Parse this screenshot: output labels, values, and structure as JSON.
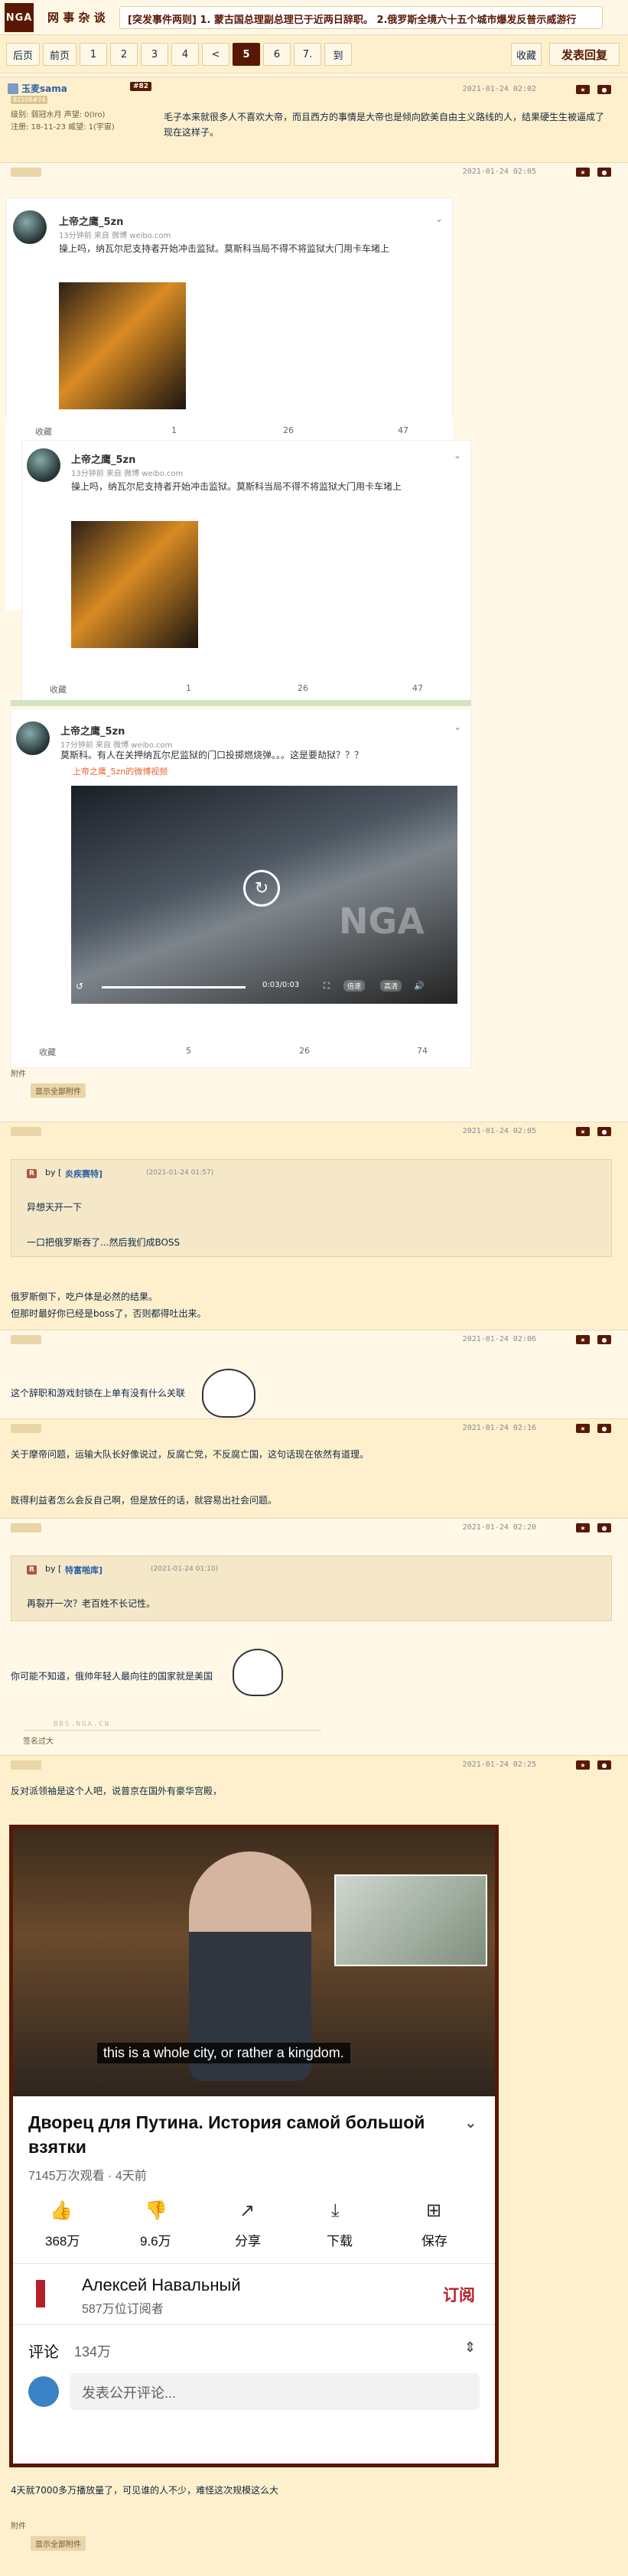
{
  "header": {
    "logo": "NGA",
    "forum": "网 事 杂 谈",
    "headline": "[突发事件两则] 1. 蒙古国总理副总理已于近两日辞职。 2.俄罗斯全境六十五个城市爆发反普示威游行"
  },
  "pager": {
    "items": [
      "后页",
      "前页",
      "1",
      "2",
      "3",
      "4",
      "<",
      "5",
      "6",
      "7.",
      "到"
    ],
    "current": "5",
    "fav": "收藏",
    "reply": "发表回复"
  },
  "posts": [
    {
      "user": "玉麦sama",
      "floor": "#82",
      "badge": "82109#74",
      "stats": [
        "级别: 弱冠水月  声望: 0(Iro)",
        "注册: 18-11-23  威望: 1(宇宙)"
      ],
      "time": "2021-01-24 02:02",
      "text": "毛子本来就很多人不喜欢大帝，而且西方的事情是大帝也是倾向欧美自由主义路线的人，结果硬生生被逼成了现在这样子。"
    },
    {
      "time": "2021-01-24 02:05",
      "weibo": [
        {
          "user": "上帝之鹰_5zn",
          "sub": "13分钟前 来自 微博 weibo.com",
          "text": "操上吗，纳瓦尔尼支持者开始冲击监狱。莫斯科当局不得不将监狱大门用卡车堵上",
          "actions": [
            "收藏",
            "1",
            "26",
            "47"
          ]
        },
        {
          "user": "上帝之鹰_5zn",
          "sub": "13分钟前 来自 微博 weibo.com",
          "text": "操上吗，纳瓦尔尼支持者开始冲击监狱。莫斯科当局不得不将监狱大门用卡车堵上",
          "actions": [
            "收藏",
            "1",
            "26",
            "47"
          ]
        },
        {
          "user": "上帝之鹰_5zn",
          "sub": "17分钟前 来自 微博 weibo.com",
          "text": "莫斯科。有人在关押纳瓦尔尼监狱的门口投掷燃烧弹。。。这是要劫狱？？？",
          "link": "上帝之鹰_5zn的微博视频",
          "video_time": "0:03/0:03",
          "video_btns": [
            "倍速",
            "高清"
          ],
          "actions": [
            "收藏",
            "5",
            "26",
            "74"
          ]
        }
      ],
      "attach": "附件",
      "show_attach": "显示全部附件"
    },
    {
      "time": "2021-01-24 02:05",
      "quote_by": "by [",
      "quote_user": "炎疾赛特]",
      "quote_time": "(2021-01-24 01:57)",
      "quote_lines": [
        "异想天开一下",
        "一口把俄罗斯吞了...然后我们成BOSS"
      ],
      "lines": [
        "俄罗斯倒下，吃户体是必然的结果。",
        "但那时最好你已经是boss了，否则都得吐出来。"
      ]
    },
    {
      "time": "2021-01-24 02:06",
      "text": "这个辞职和游戏封锁在上单有没有什么关联"
    },
    {
      "time": "2021-01-24 02:16",
      "lines": [
        "关于摩帝问题，运输大队长好像说过，反腐亡党，不反腐亡国，这句话现在依然有道理。",
        "既得利益者怎么会反自己啊，但是放任的话，就容易出社会问题。"
      ]
    },
    {
      "time": "2021-01-24 02:20",
      "quote_by": "by [",
      "quote_user": "特富啪库]",
      "quote_time": "(2021-01-24 01:10)",
      "quote_lines": [
        "再裂开一次？老百姓不长记性。"
      ],
      "text": "你可能不知道，俄帅年轻人最向往的国家就是美国",
      "sig": "签名过大",
      "watermark": "BBS.NGA.CN"
    },
    {
      "time": "2021-01-24 02:25",
      "text": "反对派领袖是这个人吧，说普京在国外有豪华宫殿，",
      "youtube": {
        "subtitle": "this is a whole city, or rather a kingdom.",
        "title": "Дворец для Путина. История самой большой взятки",
        "views": "7145万次观看 · 4天前",
        "actions": [
          "368万",
          "9.6万",
          "分享",
          "下载",
          "保存"
        ],
        "channel": "Алексей Навальный",
        "subs": "587万位订阅者",
        "subscribe": "订阅",
        "comments_label": "评论",
        "comments_count": "134万",
        "comment_placeholder": "发表公开评论..."
      },
      "after": "4天就7000多万播放量了，可见谁的人不少，难怪这次规模这么大",
      "attach": "附件",
      "show_attach": "显示全部附件"
    }
  ],
  "colors": {
    "brand": "#591804",
    "bg": "#fff8e7",
    "bg_alt": "#fff0cd",
    "youtube_red": "#b4202a"
  }
}
